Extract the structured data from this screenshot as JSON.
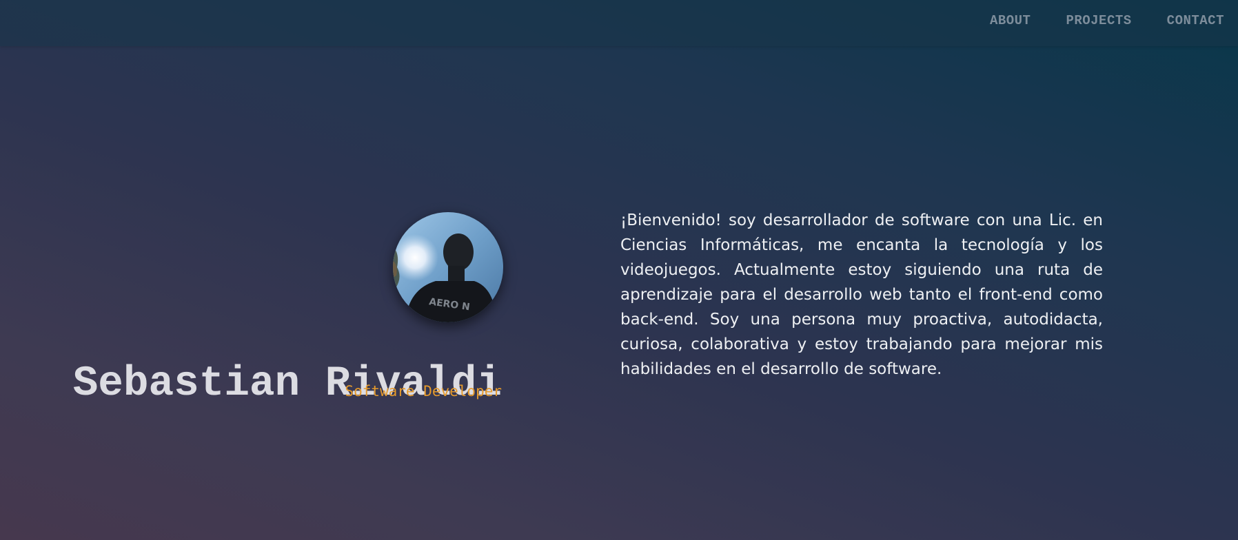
{
  "nav": {
    "items": [
      "ABOUT",
      "PROJECTS",
      "CONTACT"
    ]
  },
  "profile": {
    "name": "Sebastian Rivaldi",
    "role": "Software Developer"
  },
  "about": {
    "text": "¡Bienvenido! soy desarrollador de software con una Lic. en Ciencias Informáticas, me encanta la tecnología y los videojuegos. Actualmente estoy siguiendo una ruta de aprendizaje para el desarrollo web tanto el front-end como back-end. Soy una persona muy proactiva, autodidacta, curiosa, colaborativa y estoy trabajando para mejorar mis habilidades en el desarrollo de software."
  },
  "colors": {
    "accent": "#e59a2c",
    "name_text": "#dcdce2",
    "nav_text": "#7d8d9b"
  }
}
